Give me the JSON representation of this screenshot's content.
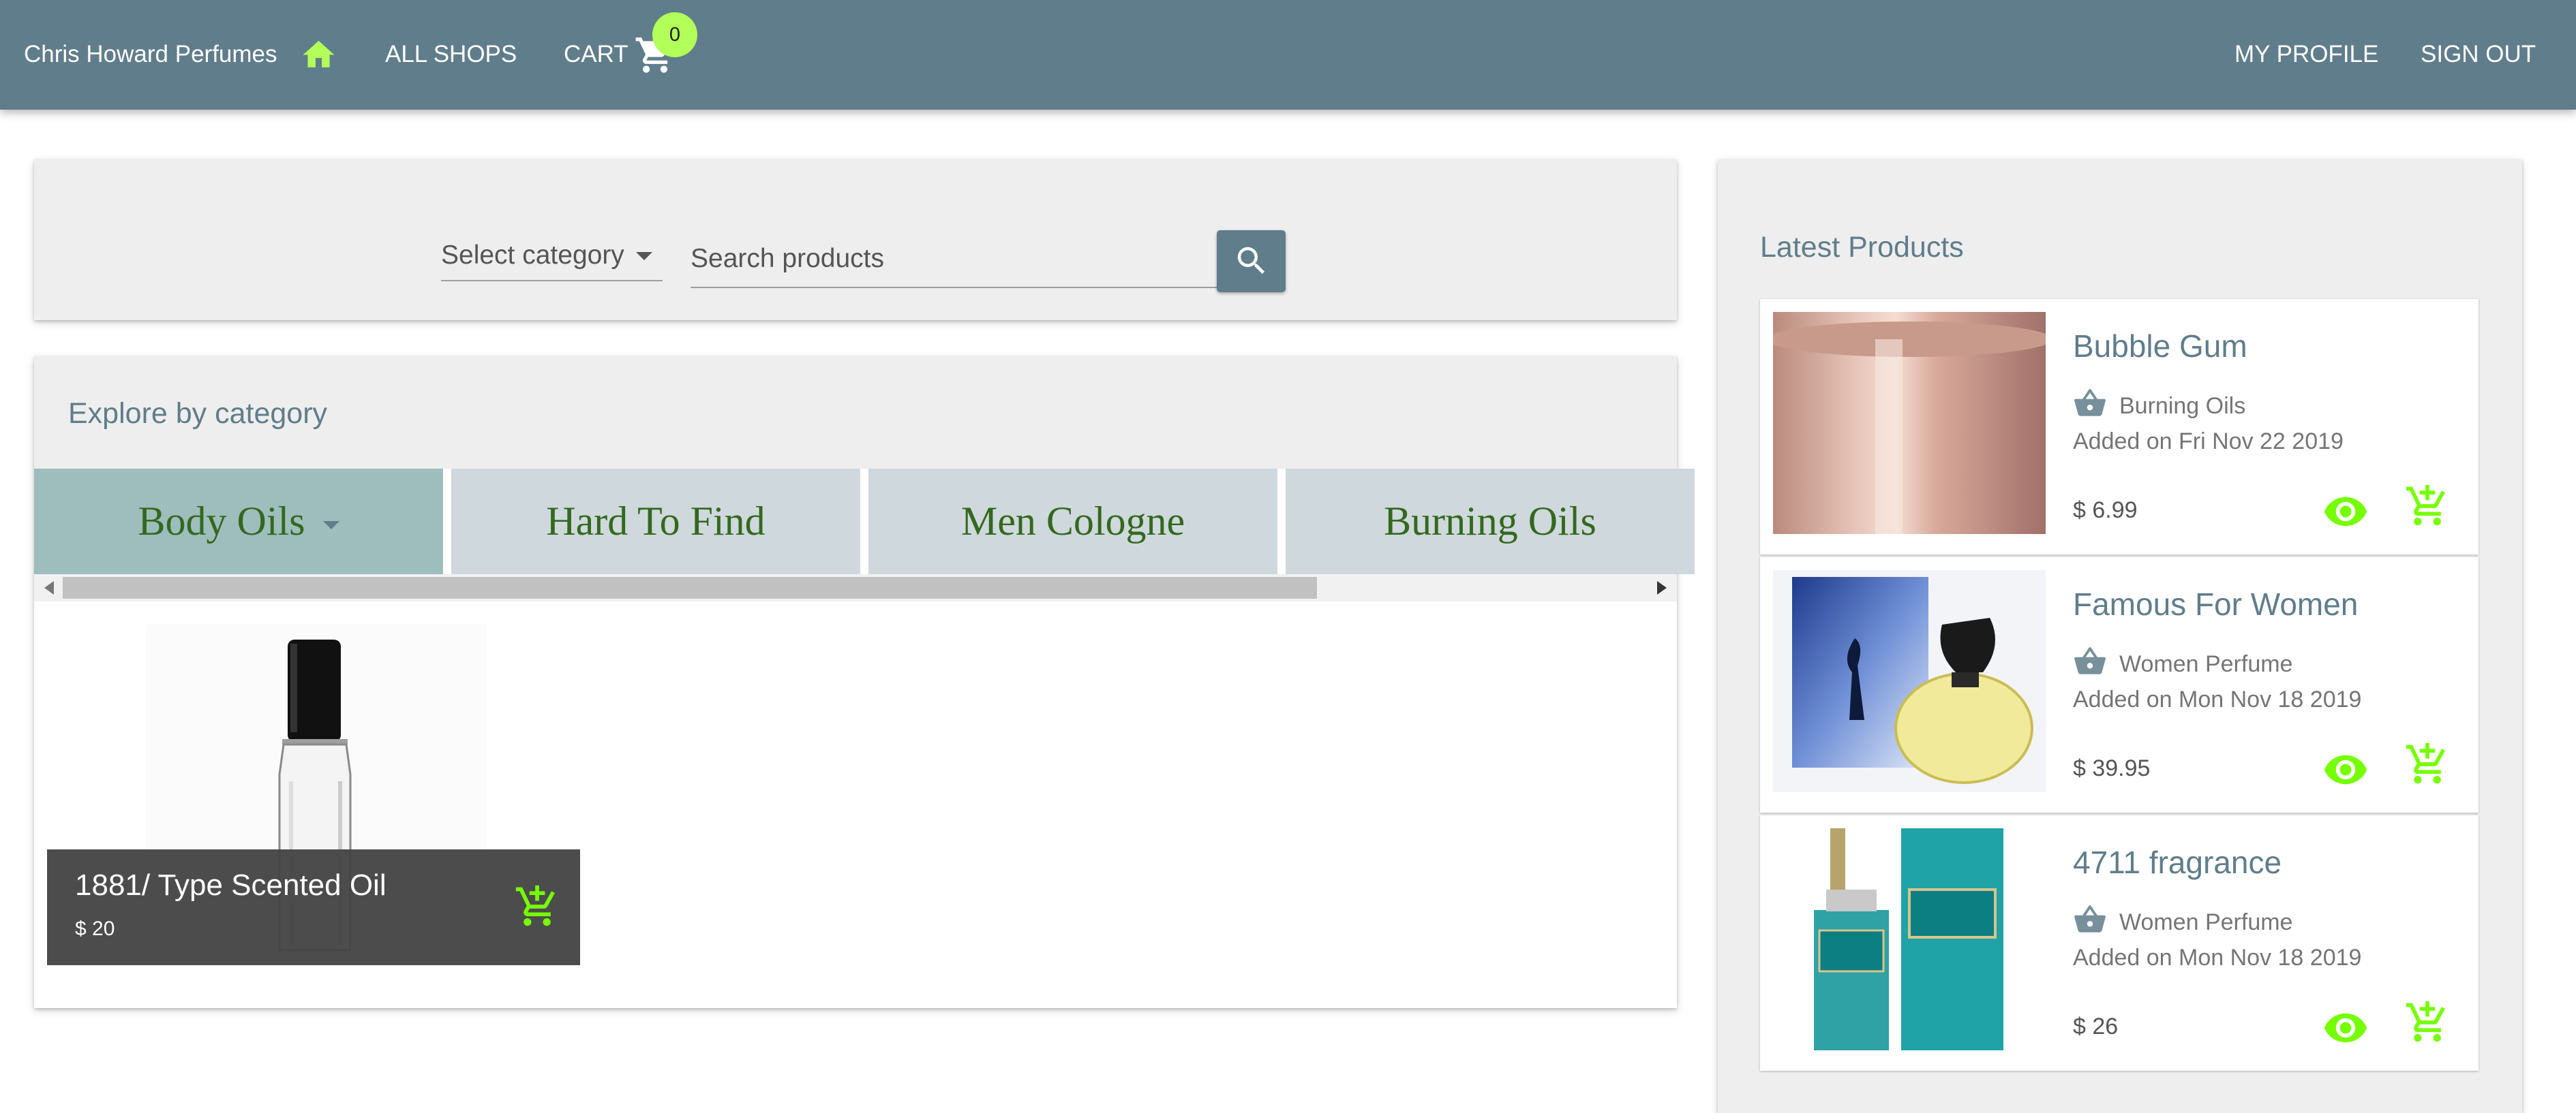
{
  "appbar": {
    "brand": "Chris Howard Perfumes",
    "nav_all_shops": "ALL SHOPS",
    "nav_cart": "CART",
    "cart_count": "0",
    "nav_my_profile": "MY PROFILE",
    "nav_sign_out": "SIGN OUT",
    "icons": {
      "home": "home-icon",
      "cart": "shopping-cart-icon"
    }
  },
  "search": {
    "category_select": "Select category",
    "placeholder": "Search products",
    "value": "",
    "button_icon": "search-icon"
  },
  "explore": {
    "title": "Explore by category",
    "categories": [
      {
        "label": "Body Oils",
        "active": true
      },
      {
        "label": "Hard To Find",
        "active": false
      },
      {
        "label": "Men Cologne",
        "active": false
      },
      {
        "label": "Burning Oils",
        "active": false
      }
    ],
    "products": [
      {
        "name": "1881/ Type Scented Oil",
        "price": "$ 20"
      }
    ]
  },
  "latest": {
    "title": "Latest Products",
    "items": [
      {
        "name": "Bubble Gum",
        "category": "Burning Oils",
        "added": "Added on Fri Nov 22 2019",
        "price": "$ 6.99"
      },
      {
        "name": "Famous For Women",
        "category": "Women Perfume",
        "added": "Added on Mon Nov 18 2019",
        "price": "$ 39.95"
      },
      {
        "name": "4711 fragrance",
        "category": "Women Perfume",
        "added": "Added on Mon Nov 18 2019",
        "price": "$ 26"
      }
    ]
  },
  "colors": {
    "appbar": "#607d8b",
    "accent": "#b2ff59",
    "action_icon": "#76ff03",
    "tab": "#cfd8dc",
    "tab_active": "#9ebdbd"
  }
}
